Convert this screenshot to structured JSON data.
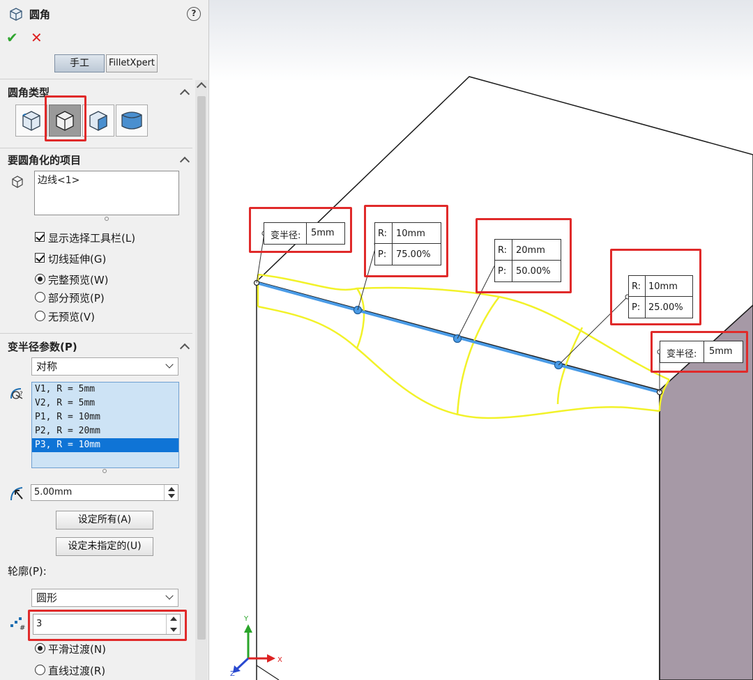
{
  "panel": {
    "title": "圆角",
    "help_label": "?",
    "ok_glyph": "✔",
    "cancel_glyph": "✕",
    "mode_tabs": [
      "手工",
      "FilletXpert"
    ],
    "sections": {
      "fillet_type": "圆角类型",
      "items_to_fillet": "要圆角化的项目",
      "variable_params": "变半径参数(P)",
      "profile": "轮廓(P):"
    },
    "items_list": [
      "边线<1>"
    ],
    "checkboxes": [
      {
        "label": "显示选择工具栏(L)",
        "checked": true
      },
      {
        "label": "切线延伸(G)",
        "checked": true
      }
    ],
    "preview_radios": [
      {
        "label": "完整预览(W)",
        "selected": true
      },
      {
        "label": "部分预览(P)",
        "selected": false
      },
      {
        "label": "无预览(V)",
        "selected": false
      }
    ],
    "symmetry_dropdown": "对称",
    "vr_list": [
      "V1, R = 5mm",
      "V2, R = 5mm",
      "P1, R = 10mm",
      "P2, R = 20mm",
      "P3, R = 10mm"
    ],
    "vr_selected_index": 4,
    "radius_value": "5.00mm",
    "set_all_label": "设定所有(A)",
    "set_unassigned_label": "设定未指定的(U)",
    "profile_dropdown": "圆形",
    "instances_value": "3",
    "transition_radios": [
      {
        "label": "平滑过渡(N)",
        "selected": true
      },
      {
        "label": "直线过渡(R)",
        "selected": false
      }
    ]
  },
  "viewport": {
    "callouts": [
      {
        "type": "vr",
        "label": "变半径:",
        "value": "5mm"
      },
      {
        "type": "rp",
        "r": "10mm",
        "p": "75.00%"
      },
      {
        "type": "rp",
        "r": "20mm",
        "p": "50.00%"
      },
      {
        "type": "rp",
        "r": "10mm",
        "p": "25.00%"
      },
      {
        "type": "vr",
        "label": "变半径:",
        "value": "5mm"
      }
    ],
    "rp_keys": {
      "r": "R:",
      "p": "P:"
    },
    "triad": {
      "x": "X",
      "y": "Y",
      "z": "Z"
    }
  },
  "colors": {
    "highlight": "#e02a2a",
    "edge_blue": "#4a9be6",
    "fillet_yellow": "#f2f229",
    "side_face": "#a699a6"
  }
}
